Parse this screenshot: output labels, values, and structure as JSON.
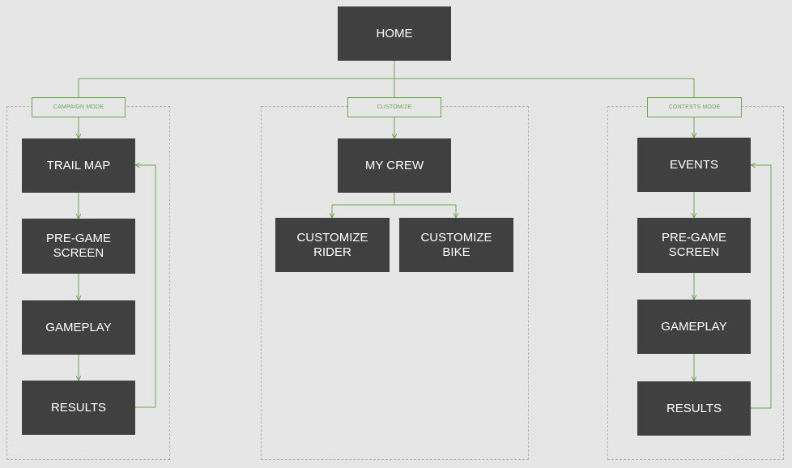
{
  "colors": {
    "background": "#e6e6e6",
    "node_fill": "#404040",
    "node_text": "#ffffff",
    "connector": "#6aa84f",
    "group_border": "#b3b3b3"
  },
  "home": "HOME",
  "campaign": {
    "label": "CAMPAIGN MODE",
    "nodes": [
      "TRAIL MAP",
      "PRE-GAME\nSCREEN",
      "GAMEPLAY",
      "RESULTS"
    ]
  },
  "customize": {
    "label": "CUSTOMIZE",
    "crew": "MY CREW",
    "rider": "CUSTOMIZE\nRIDER",
    "bike": "CUSTOMIZE\nBIKE"
  },
  "contests": {
    "label": "CONTESTS MODE",
    "nodes": [
      "EVENTS",
      "PRE-GAME\nSCREEN",
      "GAMEPLAY",
      "RESULTS"
    ]
  }
}
